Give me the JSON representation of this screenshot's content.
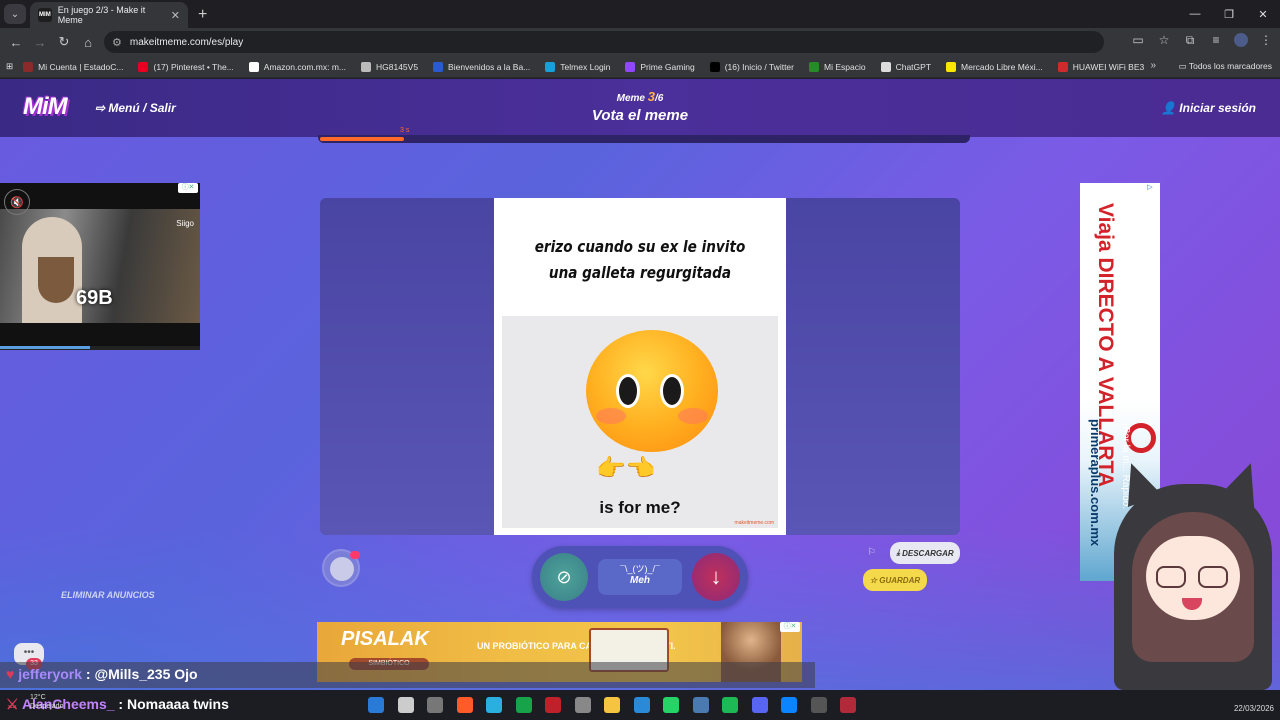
{
  "browser": {
    "tab_title": "En juego 2/3 - Make it Meme",
    "tab_favicon": "MIM",
    "url": "makeitmeme.com/es/play",
    "bookmarks": [
      {
        "label": "Mi Cuenta | EstadoC...",
        "color": "#8a2a2a"
      },
      {
        "label": "(17) Pinterest • The...",
        "color": "#e60023"
      },
      {
        "label": "Amazon.com.mx: m...",
        "color": "#ffffff"
      },
      {
        "label": "HG8145V5",
        "color": "#bbbbbb"
      },
      {
        "label": "Bienvenidos a la Ba...",
        "color": "#2a5ad0"
      },
      {
        "label": "Telmex Login",
        "color": "#1aa0d8"
      },
      {
        "label": "Prime Gaming",
        "color": "#9146ff"
      },
      {
        "label": "(16) Inicio / Twitter",
        "color": "#000000"
      },
      {
        "label": "Mi Espacio",
        "color": "#2a8a2a"
      },
      {
        "label": "ChatGPT",
        "color": "#dddddd"
      },
      {
        "label": "Mercado Libre Méxi...",
        "color": "#ffe600"
      },
      {
        "label": "HUAWEI WiFi BE3",
        "color": "#d02a2a"
      }
    ],
    "all_bookmarks": "Todos los marcadores"
  },
  "site": {
    "logo": "MiM",
    "menu": "Menú / Salir",
    "meme_label": "Meme",
    "meme_current": "3",
    "meme_total": "/6",
    "title": "Vota el meme",
    "login": "Iniciar sesión",
    "timer": "3 s",
    "progress_fraction": 0.13
  },
  "meme": {
    "caption": "erizo cuando su ex le invito una galleta regurgitada",
    "image_text": "is for me?",
    "watermark": "makeitmeme.com"
  },
  "controls": {
    "shrug": "¯\\_(ツ)_/¯",
    "meh": "Meh",
    "download": "DESCARGAR",
    "save": "GUARDAR",
    "remove_ads": "ELIMINAR ANUNCIOS"
  },
  "ads": {
    "video_counter": "69B",
    "video_brand": "Siigo",
    "right_main": "Viaja DIRECTO A VALLARTA",
    "right_site": "primeraplus.com.mx",
    "right_tagline": "¡Por la m... Rápido.",
    "bottom_brand": "PISALAK",
    "bottom_tag": "SIMBIÓTICO",
    "bottom_copy": "UN PROBIÓTICO PARA CADA VERSIÓN DE TI."
  },
  "chat": {
    "badge": "33",
    "lines": [
      {
        "user": "jefferyork",
        "message": ": @Mills_235 Ojo"
      },
      {
        "user": "AlanCheems_",
        "message": ": Nomaaaa twins"
      }
    ]
  },
  "taskbar": {
    "weather_temp": "12°C",
    "weather_desc": "Despejado",
    "date": "22/03/2026"
  }
}
